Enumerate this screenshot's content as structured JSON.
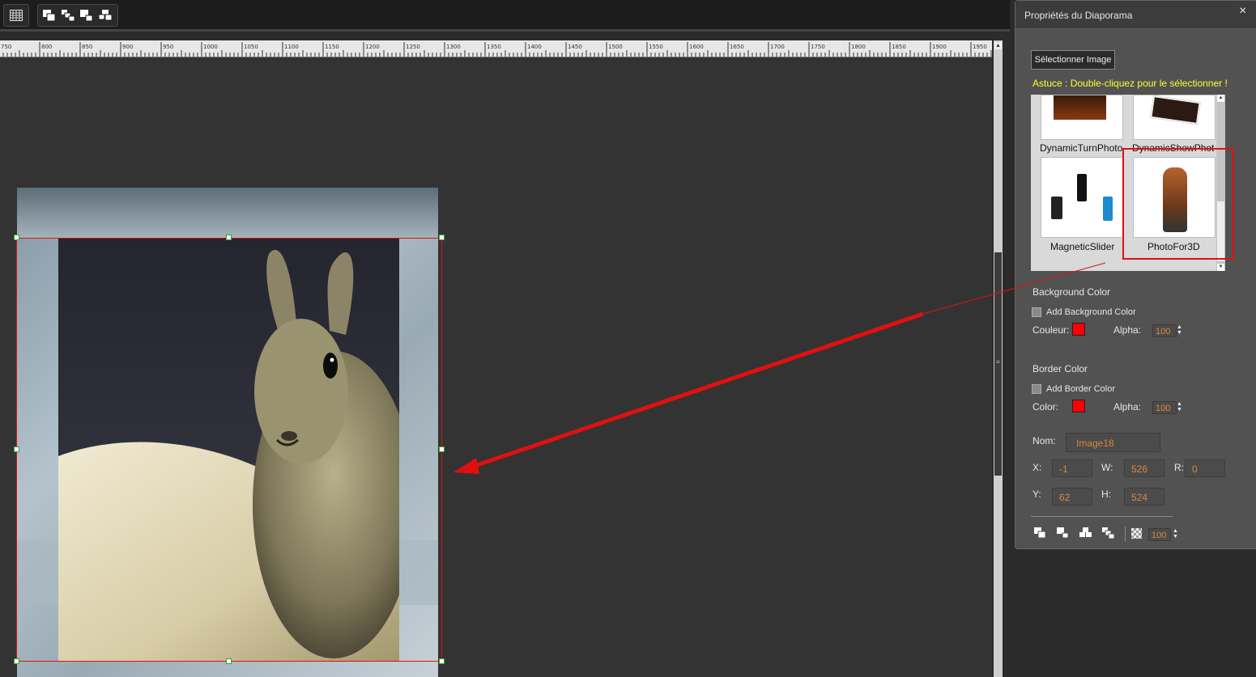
{
  "toolbar": {
    "grid_icon": "grid-icon",
    "buttons": [
      "bring-to-front-icon",
      "bring-forward-icon",
      "send-backward-icon",
      "send-to-back-icon"
    ]
  },
  "ruler": {
    "ticks": [
      "750",
      "800",
      "850",
      "900",
      "950",
      "1000",
      "1050",
      "1100",
      "1150",
      "1200",
      "1250",
      "1300",
      "1350",
      "1400",
      "1450",
      "1500",
      "1550",
      "1600",
      "1650",
      "1700",
      "1750",
      "1800",
      "1850",
      "1900",
      "1950"
    ]
  },
  "panel": {
    "title": "Propriétés du Diaporama",
    "close_glyph": "×",
    "select_image_label": "Sélectionner Image",
    "tip": "Astuce : Double-cliquez pour le sélectionner !",
    "gallery": {
      "items": [
        "DynamicTurnPhoto",
        "DynamicShowPhoto",
        "MagneticSlider",
        "PhotoFor3D"
      ],
      "selected": "PhotoFor3D"
    },
    "background": {
      "heading": "Background Color",
      "checkbox_label": "Add Background Color",
      "color_label": "Couleur:",
      "color": "#ff0000",
      "alpha_label": "Alpha:",
      "alpha_value": "100"
    },
    "border": {
      "heading": "Border Color",
      "checkbox_label": "Add Border Color",
      "color_label": "Color:",
      "color": "#ff0000",
      "alpha_label": "Alpha:",
      "alpha_value": "100"
    },
    "props": {
      "name_label": "Nom:",
      "name_value": "Image18",
      "x_label": "X:",
      "x_value": "-1",
      "w_label": "W:",
      "w_value": "526",
      "r_label": "R:",
      "r_value": "0",
      "y_label": "Y:",
      "y_value": "62",
      "h_label": "H:",
      "h_value": "524"
    },
    "bottom": {
      "buttons": [
        "bring-to-front-icon",
        "bring-forward-icon",
        "send-backward-icon",
        "send-to-back-icon"
      ],
      "opacity_icon": "transparency-icon",
      "opacity_value": "100"
    }
  },
  "colors": {
    "accent_orange": "#d7883b",
    "tip_yellow": "#ffff33",
    "selection_red": "#e01010",
    "handle_green": "#2faa2f"
  }
}
